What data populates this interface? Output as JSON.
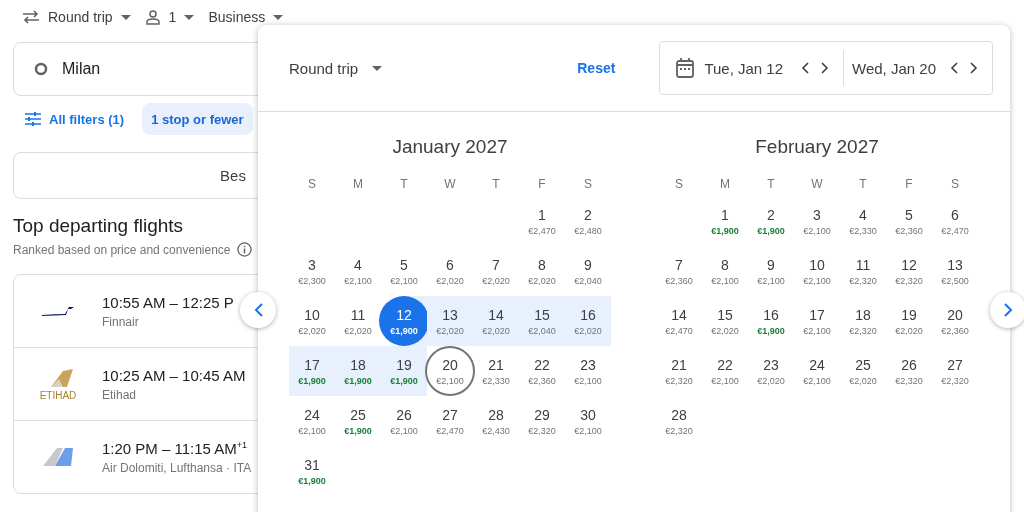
{
  "top_bar": {
    "trip_type": "Round trip",
    "passengers": "1",
    "cabin": "Business"
  },
  "search": {
    "origin": "Milan"
  },
  "filters": {
    "all_filters": "All filters (1)",
    "chips": [
      {
        "label": "1 stop or fewer",
        "selected": true
      }
    ]
  },
  "sort": {
    "label": "Bes"
  },
  "section": {
    "title": "Top departing flights",
    "subtitle": "Ranked based on price and convenience"
  },
  "flights": [
    {
      "times": "10:55 AM – 12:25 P",
      "airline": "Finnair",
      "kind": "swoosh"
    },
    {
      "times": "10:25 AM – 10:45 AM",
      "airline": "Etihad",
      "kind": "tail-gold",
      "logo_text": "ETIHAD"
    },
    {
      "times": "1:20 PM – 11:15 AM$^{+1}$",
      "airline": "Air Dolomiti, Lufthansa · ITA",
      "kind": "tail-blue"
    }
  ],
  "date_picker": {
    "trip_type": "Round trip",
    "reset": "Reset",
    "depart": "Tue, Jan 12",
    "return": "Wed, Jan 20",
    "months": [
      {
        "title": "January 2027",
        "weekdays": [
          "S",
          "M",
          "T",
          "W",
          "T",
          "F",
          "S"
        ],
        "weeks": [
          [
            {
              "kind": "blank"
            },
            {
              "kind": "blank"
            },
            {
              "kind": "blank"
            },
            {
              "kind": "blank"
            },
            {
              "kind": "blank"
            },
            {
              "kind": "plain",
              "day": "1",
              "price": "€2,470",
              "low": false
            },
            {
              "kind": "plain",
              "day": "2",
              "price": "€2,480",
              "low": false
            }
          ],
          [
            {
              "kind": "plain",
              "day": "3",
              "price": "€2,300",
              "low": false
            },
            {
              "kind": "plain",
              "day": "4",
              "price": "€2,100",
              "low": false
            },
            {
              "kind": "plain",
              "day": "5",
              "price": "€2,100",
              "low": false
            },
            {
              "kind": "plain",
              "day": "6",
              "price": "€2,020",
              "low": false
            },
            {
              "kind": "plain",
              "day": "7",
              "price": "€2,020",
              "low": false
            },
            {
              "kind": "plain",
              "day": "8",
              "price": "€2,020",
              "low": false
            },
            {
              "kind": "plain",
              "day": "9",
              "price": "€2,040",
              "low": false
            }
          ],
          [
            {
              "kind": "plain",
              "day": "10",
              "price": "€2,020",
              "low": false
            },
            {
              "kind": "plain",
              "day": "11",
              "price": "€2,020",
              "low": false
            },
            {
              "kind": "start",
              "day": "12",
              "price": "€1,900"
            },
            {
              "kind": "in_range",
              "day": "13",
              "price": "€2,020",
              "low": false
            },
            {
              "kind": "in_range",
              "day": "14",
              "price": "€2,020",
              "low": false
            },
            {
              "kind": "in_range",
              "day": "15",
              "price": "€2,040",
              "low": false
            },
            {
              "kind": "in_range",
              "day": "16",
              "price": "€2,020",
              "low": false
            }
          ],
          [
            {
              "kind": "in_range",
              "day": "17",
              "price": "€1,900",
              "low": true
            },
            {
              "kind": "in_range",
              "day": "18",
              "price": "€1,900",
              "low": true
            },
            {
              "kind": "in_range",
              "day": "19",
              "price": "€1,900",
              "low": true
            },
            {
              "kind": "end",
              "day": "20",
              "price": "€2,100",
              "low": false
            },
            {
              "kind": "plain",
              "day": "21",
              "price": "€2,330",
              "low": false
            },
            {
              "kind": "plain",
              "day": "22",
              "price": "€2,360",
              "low": false
            },
            {
              "kind": "plain",
              "day": "23",
              "price": "€2,100",
              "low": false
            }
          ],
          [
            {
              "kind": "plain",
              "day": "24",
              "price": "€2,100",
              "low": false
            },
            {
              "kind": "plain",
              "day": "25",
              "price": "€1,900",
              "low": true
            },
            {
              "kind": "plain",
              "day": "26",
              "price": "€2,100",
              "low": false
            },
            {
              "kind": "plain",
              "day": "27",
              "price": "€2,470",
              "low": false
            },
            {
              "kind": "plain",
              "day": "28",
              "price": "€2,430",
              "low": false
            },
            {
              "kind": "plain",
              "day": "29",
              "price": "€2,320",
              "low": false
            },
            {
              "kind": "plain",
              "day": "30",
              "price": "€2,100",
              "low": false
            }
          ],
          [
            {
              "kind": "plain",
              "day": "31",
              "price": "€1,900",
              "low": true
            }
          ]
        ]
      },
      {
        "title": "February 2027",
        "weekdays": [
          "S",
          "M",
          "T",
          "W",
          "T",
          "F",
          "S"
        ],
        "weeks": [
          [
            {
              "kind": "blank"
            },
            {
              "kind": "plain",
              "day": "1",
              "price": "€1,900",
              "low": true
            },
            {
              "kind": "plain",
              "day": "2",
              "price": "€1,900",
              "low": true
            },
            {
              "kind": "plain",
              "day": "3",
              "price": "€2,100",
              "low": false
            },
            {
              "kind": "plain",
              "day": "4",
              "price": "€2,330",
              "low": false
            },
            {
              "kind": "plain",
              "day": "5",
              "price": "€2,360",
              "low": false
            },
            {
              "kind": "plain",
              "day": "6",
              "price": "€2,470",
              "low": false
            }
          ],
          [
            {
              "kind": "plain",
              "day": "7",
              "price": "€2,360",
              "low": false
            },
            {
              "kind": "plain",
              "day": "8",
              "price": "€2,100",
              "low": false
            },
            {
              "kind": "plain",
              "day": "9",
              "price": "€2,100",
              "low": false
            },
            {
              "kind": "plain",
              "day": "10",
              "price": "€2,100",
              "low": false
            },
            {
              "kind": "plain",
              "day": "11",
              "price": "€2,320",
              "low": false
            },
            {
              "kind": "plain",
              "day": "12",
              "price": "€2,320",
              "low": false
            },
            {
              "kind": "plain",
              "day": "13",
              "price": "€2,500",
              "low": false
            }
          ],
          [
            {
              "kind": "plain",
              "day": "14",
              "price": "€2,470",
              "low": false
            },
            {
              "kind": "plain",
              "day": "15",
              "price": "€2,020",
              "low": false
            },
            {
              "kind": "plain",
              "day": "16",
              "price": "€1,900",
              "low": true
            },
            {
              "kind": "plain",
              "day": "17",
              "price": "€2,100",
              "low": false
            },
            {
              "kind": "plain",
              "day": "18",
              "price": "€2,320",
              "low": false
            },
            {
              "kind": "plain",
              "day": "19",
              "price": "€2,020",
              "low": false
            },
            {
              "kind": "plain",
              "day": "20",
              "price": "€2,360",
              "low": false
            }
          ],
          [
            {
              "kind": "plain",
              "day": "21",
              "price": "€2,320",
              "low": false
            },
            {
              "kind": "plain",
              "day": "22",
              "price": "€2,100",
              "low": false
            },
            {
              "kind": "plain",
              "day": "23",
              "price": "€2,020",
              "low": false
            },
            {
              "kind": "plain",
              "day": "24",
              "price": "€2,100",
              "low": false
            },
            {
              "kind": "plain",
              "day": "25",
              "price": "€2,020",
              "low": false
            },
            {
              "kind": "plain",
              "day": "26",
              "price": "€2,320",
              "low": false
            },
            {
              "kind": "plain",
              "day": "27",
              "price": "€2,320",
              "low": false
            }
          ],
          [
            {
              "kind": "plain",
              "day": "28",
              "price": "€2,320",
              "low": false
            }
          ]
        ]
      }
    ]
  }
}
